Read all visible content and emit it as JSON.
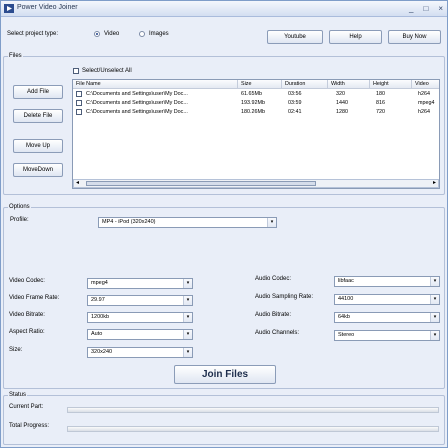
{
  "app": {
    "title": "Power Video Joiner"
  },
  "window_controls": {
    "minimize": "_",
    "restore": "□",
    "close": "×"
  },
  "project": {
    "label": "Select project type:",
    "options": [
      {
        "label": "Video",
        "selected": true
      },
      {
        "label": "Images",
        "selected": false
      }
    ]
  },
  "top_buttons": {
    "youtube": "Youtube",
    "help": "Help",
    "buy": "Buy Now"
  },
  "files": {
    "group_label": "Files",
    "select_all_label": "Select/Unselect All",
    "buttons": {
      "add": "Add File",
      "delete": "Delete File",
      "up": "Move Up",
      "down": "MoveDown"
    },
    "columns": [
      "File Name",
      "Size",
      "Duration",
      "Width",
      "Height",
      "Video"
    ],
    "rows": [
      {
        "name": "C:\\Documents and Settings\\user\\My Doc...",
        "size": "61.65Mb",
        "duration": "03:56",
        "width": "320",
        "height": "180",
        "video": "h264"
      },
      {
        "name": "C:\\Documents and Settings\\user\\My Doc...",
        "size": "193.92Mb",
        "duration": "03:59",
        "width": "1440",
        "height": "816",
        "video": "mpeg4"
      },
      {
        "name": "C:\\Documents and Settings\\user\\My Doc...",
        "size": "180.26Mb",
        "duration": "02:41",
        "width": "1280",
        "height": "720",
        "video": "h264"
      }
    ]
  },
  "options": {
    "group_label": "Options",
    "profile_label": "Profile:",
    "profile_value": "MP4 - iPod (320x240)",
    "left": [
      {
        "label": "Video Codec:",
        "value": "mpeg4"
      },
      {
        "label": "Video Frame Rate:",
        "value": "29.97"
      },
      {
        "label": "Video Bitrate:",
        "value": "1200kb"
      },
      {
        "label": "Aspect Ratio:",
        "value": "Auto"
      },
      {
        "label": "Size:",
        "value": "320x240"
      }
    ],
    "right": [
      {
        "label": "Audio Codec:",
        "value": "libfaac"
      },
      {
        "label": "Audio Sampling Rate:",
        "value": "44100"
      },
      {
        "label": "Audio Bitrate:",
        "value": "64kb"
      },
      {
        "label": "Audio Channels:",
        "value": "Stereo"
      }
    ]
  },
  "join_button": "Join Files",
  "status": {
    "group_label": "Status",
    "current_label": "Current Part:",
    "total_label": "Total Progress:",
    "current_progress": 0,
    "total_progress": 0
  }
}
